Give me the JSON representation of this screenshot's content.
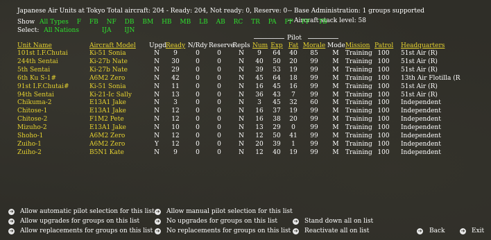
{
  "header": {
    "title": "Japanese Air Units at Tokyo  Total aircraft: 204 - Ready: 204, Not ready: 0, Reserve: 0",
    "base_admin": "-- Base Administration: 1 groups supported",
    "stack_level": "-- Aircraft stack level: 58"
  },
  "show": {
    "label": "Show",
    "filters": [
      "All Types",
      "F",
      "FB",
      "NF",
      "DB",
      "BM",
      "HB",
      "MB",
      "LB",
      "AB",
      "RC",
      "TR",
      "PA",
      "FP",
      "FF",
      "TB"
    ]
  },
  "select": {
    "label": "Select:",
    "filters": [
      "All Nations",
      "IJA",
      "IJN"
    ]
  },
  "pilot_group_label": "Pilot",
  "columns": {
    "unit_name": "Unit Name",
    "aircraft_model": "Aircraft Model",
    "upgd": "Upgd",
    "ready": "Ready",
    "nrdy": "N/Rdy",
    "reserve": "Reserve",
    "repls": "Repls",
    "num": "Num",
    "exp": "Exp",
    "fat": "Fat",
    "morale": "Morale",
    "mode": "Mode",
    "mission": "Mission",
    "patrol": "Patrol",
    "hq": "Headquarters"
  },
  "rows": [
    {
      "unit": "101st I.F.Chutai",
      "model": "Ki-51 Sonia",
      "upgd": "N",
      "ready": "9",
      "nrdy": "0",
      "reserve": "0",
      "repls": "N",
      "num": "9",
      "exp": "64",
      "fat": "40",
      "morale": "85",
      "mode": "M",
      "mission": "Training",
      "patrol": "100",
      "hq": "51st Air (R)"
    },
    {
      "unit": "244th Sentai",
      "model": "Ki-27b Nate",
      "upgd": "N",
      "ready": "30",
      "nrdy": "0",
      "reserve": "0",
      "repls": "N",
      "num": "40",
      "exp": "50",
      "fat": "20",
      "morale": "99",
      "mode": "M",
      "mission": "Training",
      "patrol": "100",
      "hq": "51st Air (R)"
    },
    {
      "unit": "5th Sentai",
      "model": "Ki-27b Nate",
      "upgd": "N",
      "ready": "29",
      "nrdy": "0",
      "reserve": "0",
      "repls": "N",
      "num": "39",
      "exp": "53",
      "fat": "19",
      "morale": "99",
      "mode": "M",
      "mission": "Training",
      "patrol": "100",
      "hq": "51st Air (R)"
    },
    {
      "unit": "6th Ku S-1#",
      "model": "A6M2 Zero",
      "upgd": "N",
      "ready": "42",
      "nrdy": "0",
      "reserve": "0",
      "repls": "N",
      "num": "45",
      "exp": "64",
      "fat": "18",
      "morale": "99",
      "mode": "M",
      "mission": "Training",
      "patrol": "100",
      "hq": "13th Air Flotilla (R"
    },
    {
      "unit": "91st I.F.Chutai#",
      "model": "Ki-51 Sonia",
      "upgd": "N",
      "ready": "11",
      "nrdy": "0",
      "reserve": "0",
      "repls": "N",
      "num": "16",
      "exp": "45",
      "fat": "16",
      "morale": "99",
      "mode": "M",
      "mission": "Training",
      "patrol": "100",
      "hq": "51st Air (R)"
    },
    {
      "unit": "94th Sentai",
      "model": "Ki-21-Ic Sally",
      "upgd": "N",
      "ready": "13",
      "nrdy": "0",
      "reserve": "0",
      "repls": "N",
      "num": "36",
      "exp": "43",
      "fat": "7",
      "morale": "99",
      "mode": "M",
      "mission": "Training",
      "patrol": "100",
      "hq": "51st Air (R)"
    },
    {
      "unit": "Chikuma-2",
      "model": "E13A1 Jake",
      "upgd": "N",
      "ready": "3",
      "nrdy": "0",
      "reserve": "0",
      "repls": "N",
      "num": "3",
      "exp": "45",
      "fat": "32",
      "morale": "60",
      "mode": "M",
      "mission": "Training",
      "patrol": "100",
      "hq": "Independent"
    },
    {
      "unit": "Chitose-1",
      "model": "E13A1 Jake",
      "upgd": "N",
      "ready": "12",
      "nrdy": "0",
      "reserve": "0",
      "repls": "N",
      "num": "16",
      "exp": "37",
      "fat": "19",
      "morale": "99",
      "mode": "M",
      "mission": "Training",
      "patrol": "100",
      "hq": "Independent"
    },
    {
      "unit": "Chitose-2",
      "model": "F1M2 Pete",
      "upgd": "N",
      "ready": "12",
      "nrdy": "0",
      "reserve": "0",
      "repls": "N",
      "num": "16",
      "exp": "38",
      "fat": "20",
      "morale": "99",
      "mode": "M",
      "mission": "Training",
      "patrol": "100",
      "hq": "Independent"
    },
    {
      "unit": "Mizuho-2",
      "model": "E13A1 Jake",
      "upgd": "N",
      "ready": "10",
      "nrdy": "0",
      "reserve": "0",
      "repls": "N",
      "num": "13",
      "exp": "29",
      "fat": "0",
      "morale": "99",
      "mode": "M",
      "mission": "Training",
      "patrol": "100",
      "hq": "Independent"
    },
    {
      "unit": "Shoho-1",
      "model": "A6M2 Zero",
      "upgd": "N",
      "ready": "12",
      "nrdy": "0",
      "reserve": "0",
      "repls": "N",
      "num": "12",
      "exp": "50",
      "fat": "41",
      "morale": "99",
      "mode": "M",
      "mission": "Training",
      "patrol": "100",
      "hq": "Independent"
    },
    {
      "unit": "Zuiho-1",
      "model": "A6M2 Zero",
      "upgd": "Y",
      "ready": "12",
      "nrdy": "0",
      "reserve": "0",
      "repls": "N",
      "num": "20",
      "exp": "39",
      "fat": "1",
      "morale": "99",
      "mode": "M",
      "mission": "Training",
      "patrol": "100",
      "hq": "Independent"
    },
    {
      "unit": "Zuiho-2",
      "model": "B5N1 Kate",
      "upgd": "N",
      "ready": "9",
      "nrdy": "0",
      "reserve": "0",
      "repls": "N",
      "num": "12",
      "exp": "40",
      "fat": "19",
      "morale": "99",
      "mode": "M",
      "mission": "Training",
      "patrol": "100",
      "hq": "Independent"
    }
  ],
  "options": {
    "auto_pilot": "Allow automatic pilot selection for this list",
    "manual_pilot": "Allow manual pilot selection for this list",
    "allow_upgrades": "Allow upgrades for groups on this list",
    "no_upgrades": "No upgrades for groups on this list",
    "stand_down": "Stand down all on list",
    "allow_repl": "Allow replacements for groups on this list",
    "no_repl": "No replacements for groups on this list",
    "reactivate": "Reactivate all on list",
    "back": "Back",
    "exit": "Exit"
  },
  "icons": {
    "bullet": "arrow-circle-icon"
  },
  "colors": {
    "background": "#2f2e28",
    "link_yellow": "#e6d230",
    "filter_green": "#2ee02e",
    "text_white": "#ffffff"
  }
}
